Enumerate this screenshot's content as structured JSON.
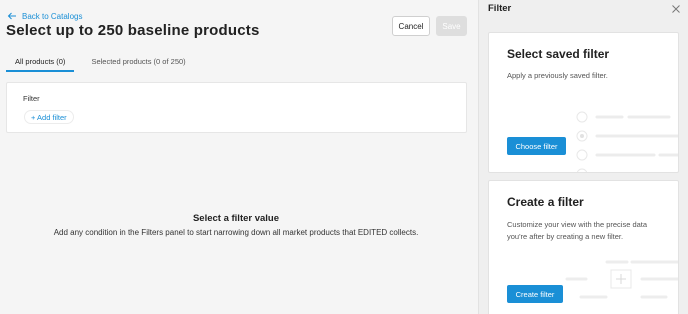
{
  "header": {
    "back_label": "Back to Catalogs",
    "title": "Select up to 250 baseline products",
    "cancel_label": "Cancel",
    "save_label": "Save"
  },
  "tabs": [
    {
      "label": "All products (0)",
      "active": true
    },
    {
      "label": "Selected products (0 of 250)",
      "active": false
    }
  ],
  "filter_bar": {
    "label": "Filter",
    "add_label": "+ Add filter"
  },
  "empty_state": {
    "title": "Select a filter value",
    "description": "Add any condition in the Filters panel to start narrowing down all market products that EDITED collects."
  },
  "panel": {
    "title": "Filter",
    "close_icon": "close-icon",
    "saved_filter": {
      "title": "Select saved filter",
      "description": "Apply a previously saved filter.",
      "button_label": "Choose filter"
    },
    "create_filter": {
      "title": "Create a filter",
      "description": "Customize your view with the precise data you're after by creating a new filter.",
      "button_label": "Create filter"
    }
  },
  "colors": {
    "accent": "#1a8fd6",
    "panel_bg": "#efefef",
    "page_bg": "#f5f5f5"
  }
}
